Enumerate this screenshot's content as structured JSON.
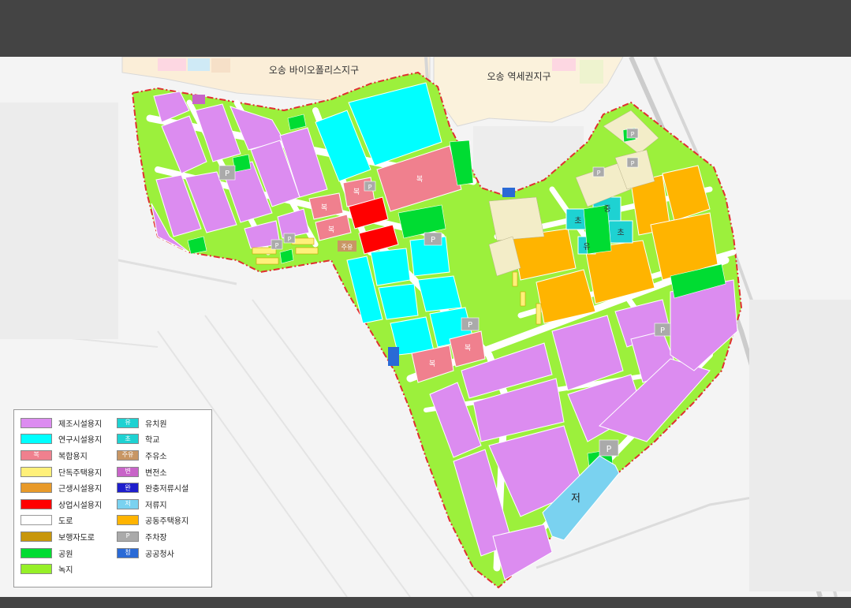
{
  "map": {
    "district_labels": {
      "north_left": "오송 바이오폴리스지구",
      "north_right": "오송 역세권지구"
    },
    "parcel_marks": {
      "mixed": "복",
      "school": "초",
      "middle_school": "중",
      "kindergarten": "유",
      "parking": "P",
      "gas_station": "주유",
      "reservoir": "저"
    }
  },
  "legend": {
    "items": [
      {
        "label": "제조시설용지",
        "color": "#dc8cf0",
        "mark": ""
      },
      {
        "label": "연구시설용지",
        "color": "#00ffff",
        "mark": ""
      },
      {
        "label": "복합용지",
        "color": "#f0808e",
        "mark": "복"
      },
      {
        "label": "단독주택용지",
        "color": "#fff07a",
        "mark": ""
      },
      {
        "label": "근생시설용지",
        "color": "#e89a2a",
        "mark": ""
      },
      {
        "label": "상업시설용지",
        "color": "#ff0000",
        "mark": ""
      },
      {
        "label": "도로",
        "color": "#ffffff",
        "mark": ""
      },
      {
        "label": "보행자도로",
        "color": "#c8960a",
        "mark": ""
      },
      {
        "label": "공원",
        "color": "#00dc32",
        "mark": ""
      },
      {
        "label": "녹지",
        "color": "#96f028",
        "mark": ""
      },
      {
        "label": "유치원",
        "color": "#1ed2d2",
        "mark": "유"
      },
      {
        "label": "학교",
        "color": "#1ed2d2",
        "mark": "초"
      },
      {
        "label": "주유소",
        "color": "#c89664",
        "mark": "주유"
      },
      {
        "label": "변전소",
        "color": "#c864c8",
        "mark": "변"
      },
      {
        "label": "완충저류시설",
        "color": "#1e1ecc",
        "mark": "완"
      },
      {
        "label": "저류지",
        "color": "#7ad2f0",
        "mark": "저"
      },
      {
        "label": "공동주택용지",
        "color": "#ffb400",
        "mark": ""
      },
      {
        "label": "주차장",
        "color": "#aaaaaa",
        "mark": "P"
      },
      {
        "label": "공공청사",
        "color": "#2a6ad6",
        "mark": "청"
      }
    ]
  }
}
